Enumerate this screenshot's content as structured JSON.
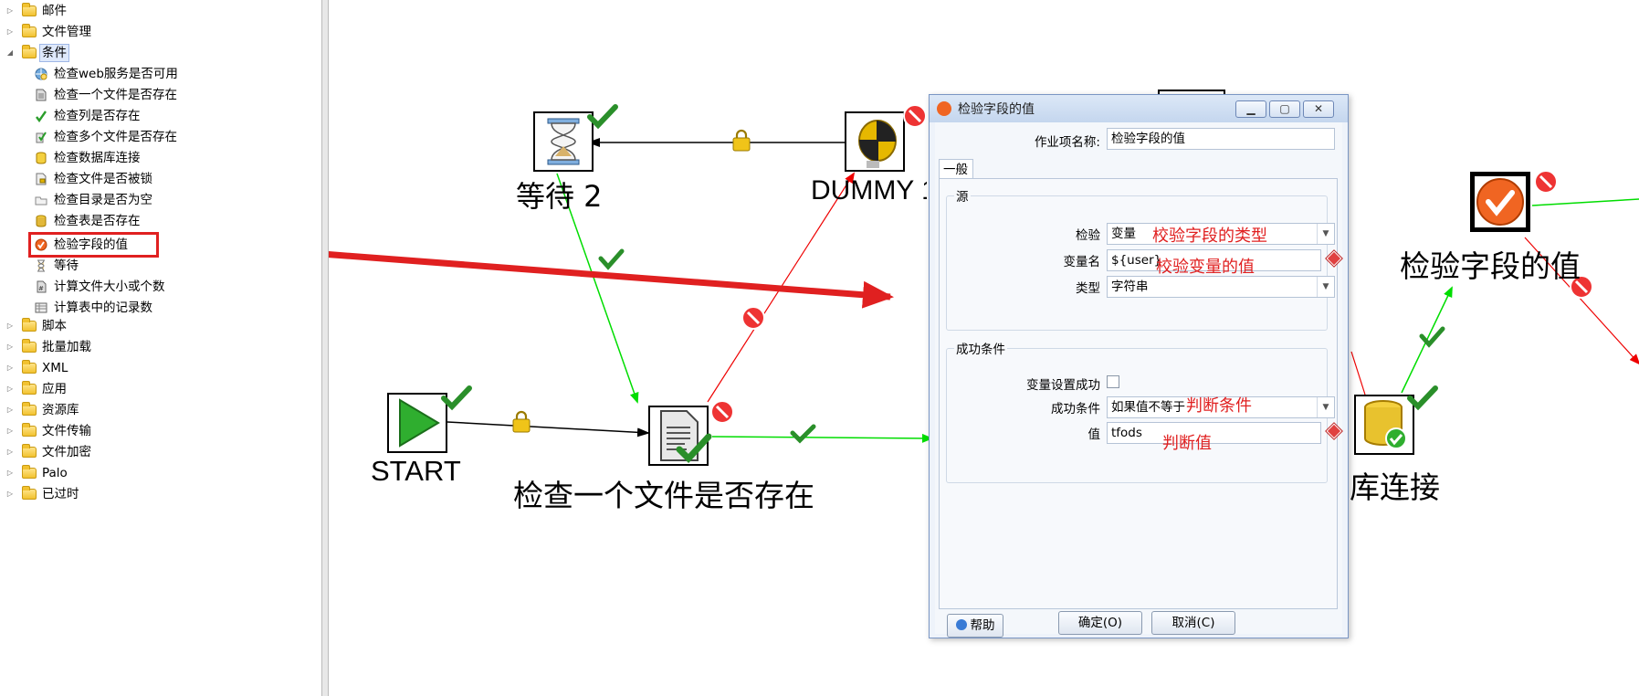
{
  "tree": {
    "folders_top": [
      {
        "label": "邮件"
      },
      {
        "label": "文件管理"
      }
    ],
    "open_folder": {
      "label": "条件"
    },
    "leaves": [
      {
        "label": "检查web服务是否可用",
        "icon": "globe-check-icon"
      },
      {
        "label": "检查一个文件是否存在",
        "icon": "file-icon"
      },
      {
        "label": "检查列是否存在",
        "icon": "check-column-icon"
      },
      {
        "label": "检查多个文件是否存在",
        "icon": "multi-file-check-icon"
      },
      {
        "label": "检查数据库连接",
        "icon": "database-icon"
      },
      {
        "label": "检查文件是否被锁",
        "icon": "locked-file-icon"
      },
      {
        "label": "检查目录是否为空",
        "icon": "empty-folder-icon"
      },
      {
        "label": "检查表是否存在",
        "icon": "table-exists-icon"
      },
      {
        "label": "检验字段的值",
        "icon": "validate-field-icon"
      },
      {
        "label": "等待",
        "icon": "hourglass-icon"
      },
      {
        "label": "计算文件大小或个数",
        "icon": "file-size-icon"
      },
      {
        "label": "计算表中的记录数",
        "icon": "table-count-icon"
      }
    ],
    "folders_bottom": [
      {
        "label": "脚本"
      },
      {
        "label": "批量加载"
      },
      {
        "label": "XML"
      },
      {
        "label": "应用"
      },
      {
        "label": "资源库"
      },
      {
        "label": "文件传输"
      },
      {
        "label": "文件加密"
      },
      {
        "label": "Palo"
      },
      {
        "label": "已过时"
      }
    ]
  },
  "canvas": {
    "entries": {
      "wait": {
        "caption": "等待 2",
        "icon": "hourglass-icon"
      },
      "dummy": {
        "caption": "DUMMY 1",
        "icon": "dummy-head-icon"
      },
      "start": {
        "caption": "START",
        "icon": "start-play-icon"
      },
      "check_file": {
        "caption": "检查一个文件是否存在",
        "icon": "document-icon"
      },
      "validate": {
        "caption": "检验字段的值",
        "icon": "validate-field-icon"
      },
      "db_conn": {
        "caption": "数据库连接",
        "icon": "database-icon"
      }
    },
    "colors": {
      "success_hop": "#00dd00",
      "fail_hop": "#ee0000",
      "unconditional_hop": "#000000",
      "annotation": "#e02020"
    }
  },
  "dialog": {
    "title": "检验字段的值",
    "window_buttons": {
      "minimize": "▁",
      "maximize": "▢",
      "close": "✕"
    },
    "job_entry_name_label": "作业项名称:",
    "job_entry_name_value": "检验字段的值",
    "tab_general": "一般",
    "source_group": "源",
    "check_label": "检验",
    "check_value": "变量",
    "varname_label": "变量名",
    "varname_value": "${user}",
    "type_label": "类型",
    "type_value": "字符串",
    "success_group": "成功条件",
    "var_set_success_label": "变量设置成功",
    "success_condition_label": "成功条件",
    "success_condition_value": "如果值不等于",
    "value_label": "值",
    "value_value": "tfods",
    "help_button": "帮助",
    "ok_button": "确定(O)",
    "cancel_button": "取消(C)"
  },
  "annotations": {
    "field_type": "校验字段的类型",
    "var_value": "校验变量的值",
    "condition": "判断条件",
    "value": "判断值"
  }
}
